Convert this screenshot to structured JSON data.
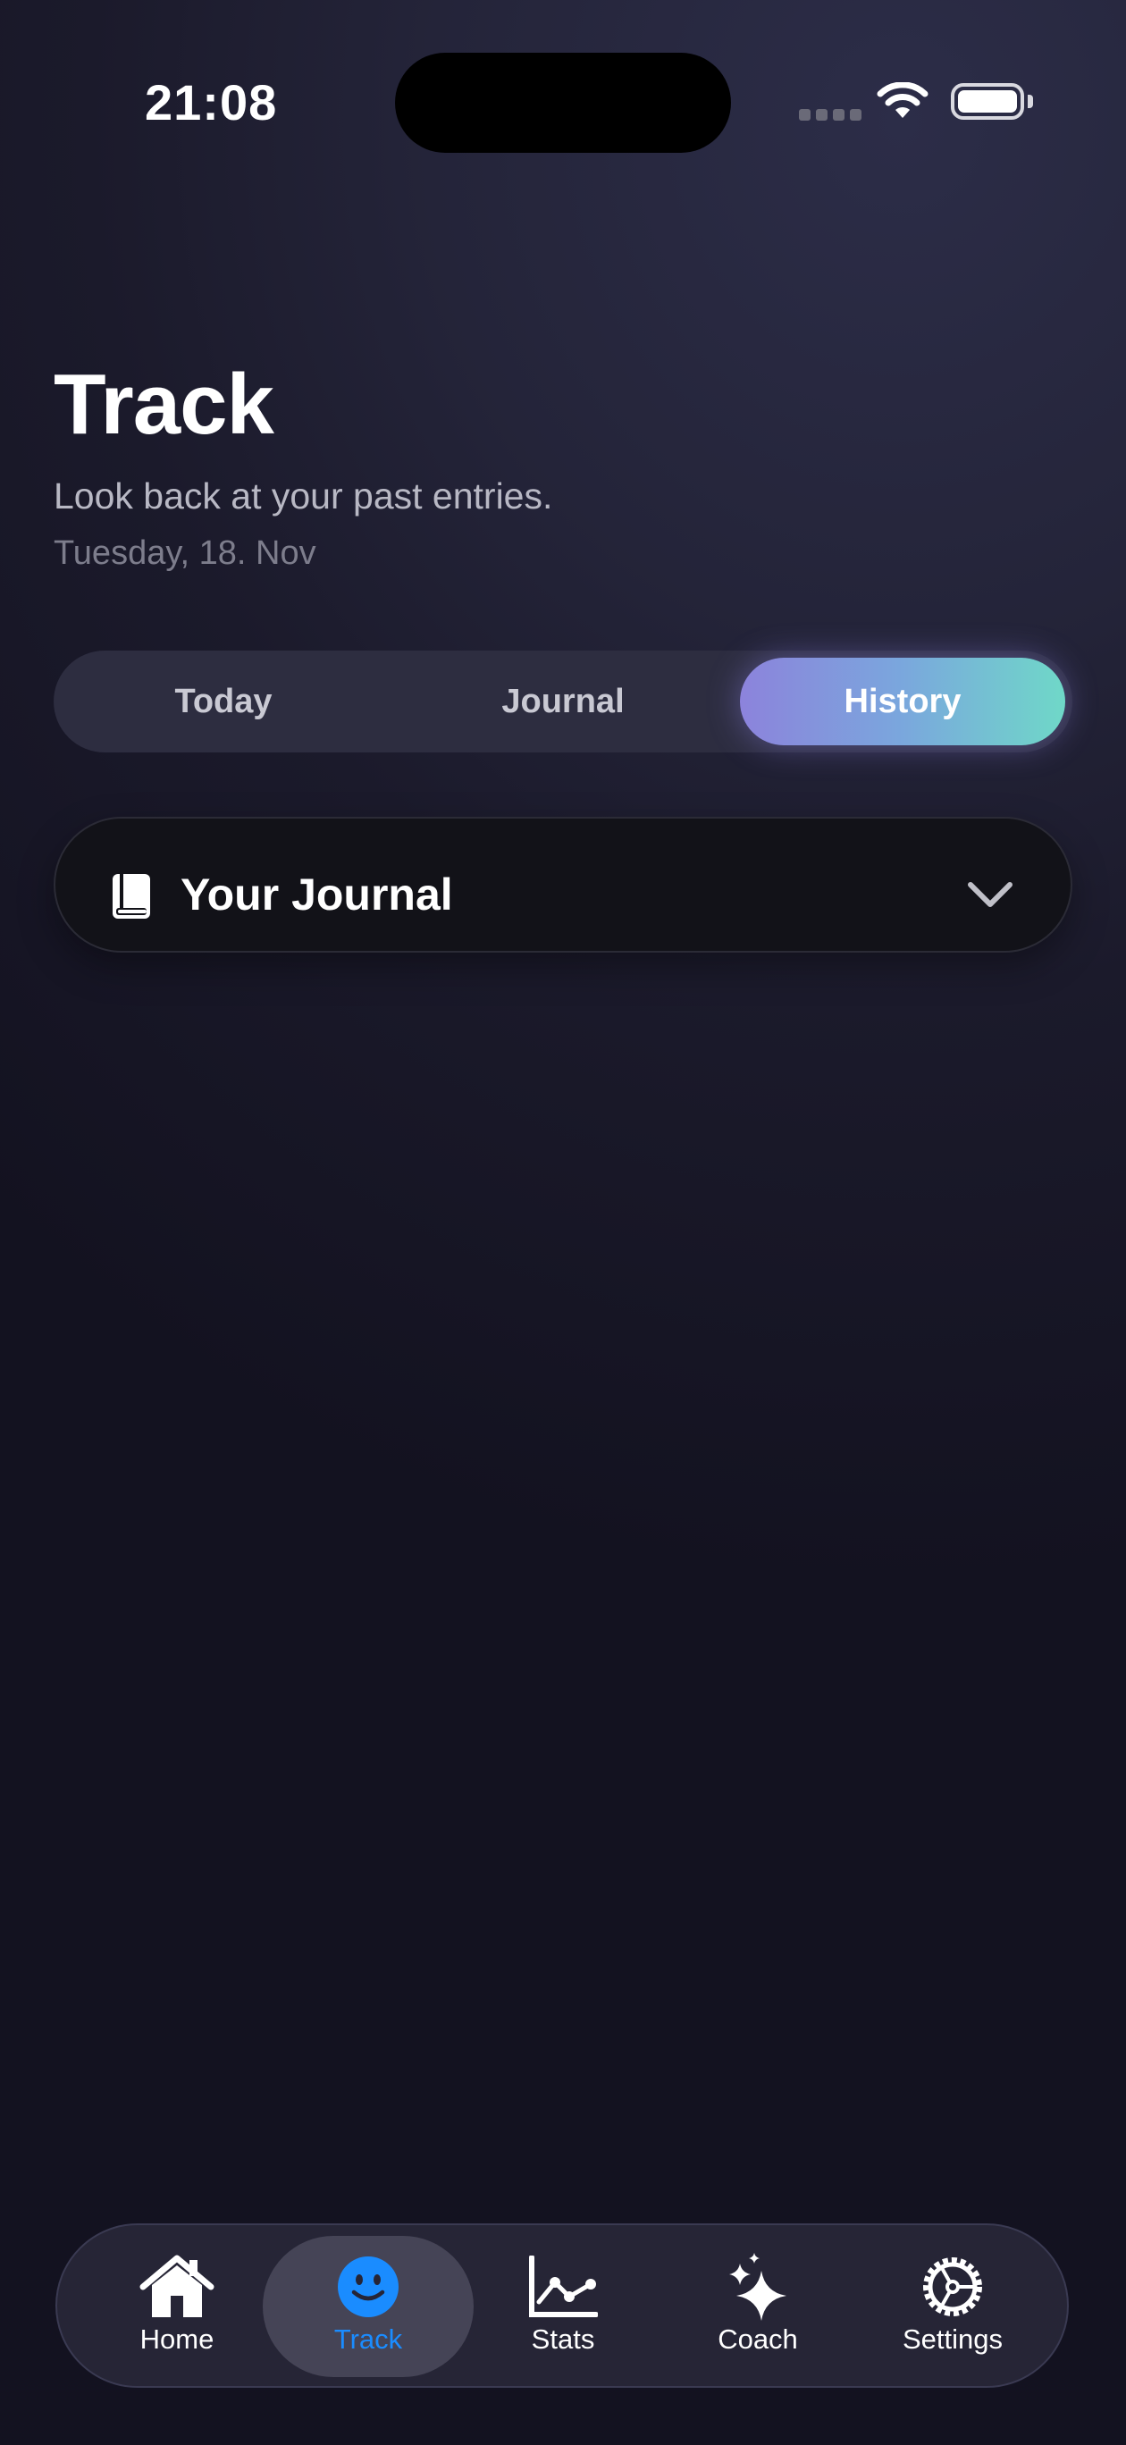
{
  "status_bar": {
    "time": "21:08"
  },
  "header": {
    "title": "Track",
    "subtitle": "Look back at your past entries.",
    "date": "Tuesday, 18. Nov"
  },
  "segments": {
    "items": [
      {
        "label": "Today",
        "selected": false
      },
      {
        "label": "Journal",
        "selected": false
      },
      {
        "label": "History",
        "selected": true
      }
    ]
  },
  "journal_selector": {
    "icon": "book-icon",
    "label": "Your Journal",
    "expand_icon": "chevron-down-icon"
  },
  "tab_bar": {
    "items": [
      {
        "label": "Home",
        "icon": "home-icon",
        "selected": false
      },
      {
        "label": "Track",
        "icon": "smiley-icon",
        "selected": true
      },
      {
        "label": "Stats",
        "icon": "line-chart-icon",
        "selected": false
      },
      {
        "label": "Coach",
        "icon": "sparkles-icon",
        "selected": false
      },
      {
        "label": "Settings",
        "icon": "gear-icon",
        "selected": false
      }
    ]
  },
  "colors": {
    "accent_blue": "#1a8cff",
    "gradient_start": "#8c83dc",
    "gradient_end": "#6fd8c8",
    "background_top": "#2c2d48",
    "background_bottom": "#131220"
  }
}
